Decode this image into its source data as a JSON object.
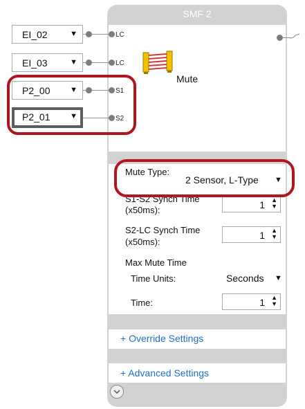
{
  "block": {
    "title": "SMF 2",
    "function_label": "Mute"
  },
  "inputs": [
    {
      "value": "EI_02",
      "pin": "LC"
    },
    {
      "value": "EI_03",
      "pin": "LC"
    },
    {
      "value": "P2_00",
      "pin": "S1"
    },
    {
      "value": "P2_01",
      "pin": "S2"
    }
  ],
  "settings": {
    "mute_type": {
      "label": "Mute Type:",
      "value": "2 Sensor, L-Type"
    },
    "s1_s2_synch": {
      "label_line1": "S1-S2 Synch Time",
      "label_line2": "(x50ms):",
      "value": "1"
    },
    "s2_lc_synch": {
      "label_line1": "S2-LC Synch Time",
      "label_line2": "(x50ms):",
      "value": "1"
    },
    "max_mute_time": {
      "label": "Max Mute Time"
    },
    "time_units": {
      "label": "Time Units:",
      "value": "Seconds"
    },
    "time": {
      "label": "Time:",
      "value": "1"
    }
  },
  "links": {
    "override": "+ Override Settings",
    "advanced": "+ Advanced Settings"
  },
  "colors": {
    "highlight": "#b0161d",
    "link": "#1f6fc5",
    "block_gray": "#d2d2d2"
  },
  "icons": {
    "mute": "light-curtain-icon",
    "expand": "chevron-down-icon",
    "dropdown": "triangle-down-icon"
  }
}
